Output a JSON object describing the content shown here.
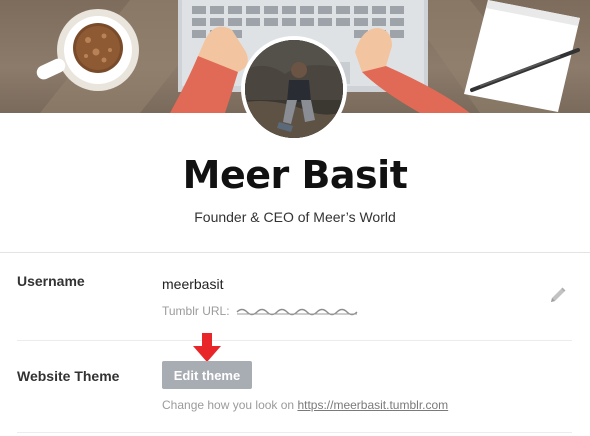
{
  "profile": {
    "name": "Meer Basit",
    "bio": "Founder & CEO of Meer’s World"
  },
  "username_row": {
    "label": "Username",
    "value": "meerbasit",
    "tumblr_url_prefix": "Tumblr URL:",
    "edit_icon": "pencil-icon"
  },
  "theme_row": {
    "label": "Website Theme",
    "button_label": "Edit theme",
    "helper_prefix": "Change how you look on",
    "helper_link": "https://meerbasit.tumblr.com"
  },
  "annotation": {
    "arrow_color": "#e8262a",
    "icon": "down-arrow-icon"
  },
  "colors": {
    "button_bg": "#a8acb3",
    "banner": "#8a7969"
  }
}
